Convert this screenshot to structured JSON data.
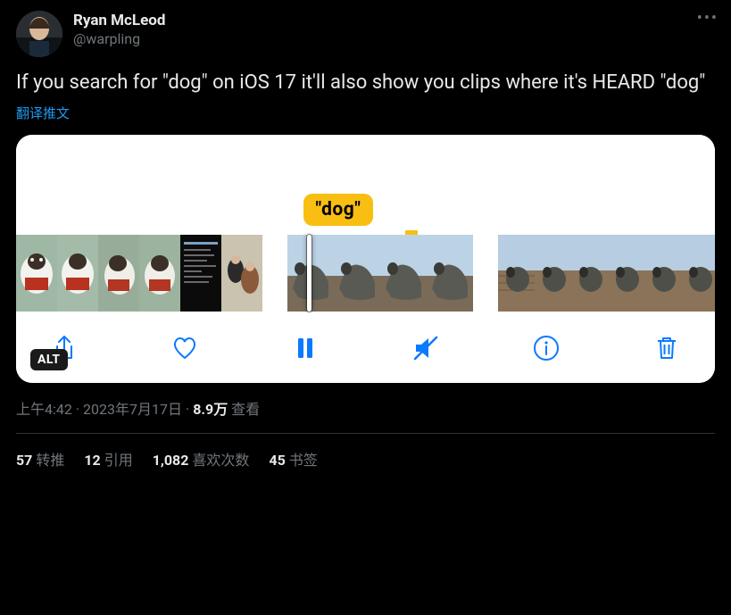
{
  "author": {
    "display_name": "Ryan McLeod",
    "handle": "@warpling"
  },
  "tweet_text": "If you search for \"dog\" on iOS 17 it'll also show you clips where it's HEARD \"dog\"",
  "translate_label": "翻译推文",
  "media": {
    "search_label": "\"dog\"",
    "alt_badge": "ALT",
    "controls": {
      "share": "share",
      "like": "like",
      "pause": "pause",
      "mute": "mute",
      "info": "info",
      "delete": "delete"
    }
  },
  "meta": {
    "time": "上午4:42",
    "date": "2023年7月17日",
    "views_number": "8.9万",
    "views_label": "查看"
  },
  "stats": {
    "retweets_num": "57",
    "retweets_label": "转推",
    "quotes_num": "12",
    "quotes_label": "引用",
    "likes_num": "1,082",
    "likes_label": "喜欢次数",
    "bookmarks_num": "45",
    "bookmarks_label": "书签"
  }
}
